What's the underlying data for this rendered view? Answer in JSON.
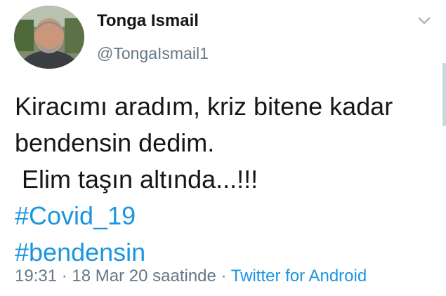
{
  "tweet": {
    "display_name": "Tonga Ismail",
    "handle": "@TongaIsmail1",
    "text_lines": [
      "Kiracımı aradım, kriz bitene kadar",
      "bendensin dedim.",
      " Elim taşın altında...!!!"
    ],
    "hashtags": [
      "#Covid_19",
      "#bendensin"
    ],
    "time": "19:31",
    "date": "18 Mar 20 saatinde",
    "separator": "·",
    "source": "Twitter for Android"
  },
  "colors": {
    "text": "#14171a",
    "secondary": "#657786",
    "link": "#1b95e0"
  },
  "icons": {
    "menu": "chevron-down-icon",
    "avatar": "avatar"
  }
}
